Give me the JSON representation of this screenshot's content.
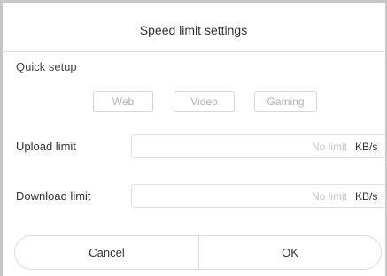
{
  "dialog": {
    "title": "Speed limit settings"
  },
  "quick_setup": {
    "label": "Quick setup",
    "presets": [
      "Web",
      "Video",
      "Gaming"
    ]
  },
  "upload": {
    "label": "Upload limit",
    "placeholder": "No limit",
    "value": "",
    "unit": "KB/s"
  },
  "download": {
    "label": "Download limit",
    "placeholder": "No limit",
    "value": "",
    "unit": "KB/s"
  },
  "buttons": {
    "cancel": "Cancel",
    "ok": "OK"
  },
  "colors": {
    "border": "#c7c7c7",
    "text": "#333333",
    "muted": "#b3b3b3",
    "placeholder": "#c4c4c4"
  }
}
